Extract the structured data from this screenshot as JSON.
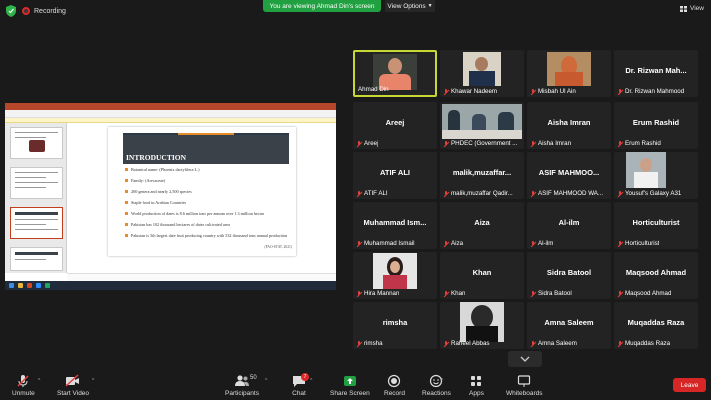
{
  "topbar": {
    "recording_label": "Recording",
    "share_banner": "You are viewing Ahmad Din's screen",
    "view_options_label": "View Options",
    "view_label": "View"
  },
  "screen": {
    "slide_title": "INTRODUCTION",
    "bullets": [
      "Botanical name: (Phoenix dactylifera L.)",
      "Family: (Arecaceae)",
      "200 genera and nearly 2,500 species",
      "Staple food in Arabian Countries",
      "World production of dates is 8.6 million tons per annum over 1.3 million hectar",
      "Pakistan has 102 thousand hectares of dates cultivated area",
      "Pakistan is 5th largest date fruit producing country with 532 thousand tons annual production"
    ],
    "source_note": "(FAO-STAT, 2021)"
  },
  "participants": [
    {
      "big": "",
      "label": "Ahmad Din",
      "muted": false,
      "photo": "ahmad",
      "active": true
    },
    {
      "big": "",
      "label": "Khawar Nadeem",
      "muted": true,
      "photo": "khawar",
      "active": false
    },
    {
      "big": "",
      "label": "Misbah Ul Ain",
      "muted": true,
      "photo": "misbah",
      "active": false
    },
    {
      "big": "Dr. Rizwan Mah...",
      "label": "Dr. Rizwan Mahmood",
      "muted": true,
      "photo": "",
      "active": false
    },
    {
      "big": "Areej",
      "label": "Areej",
      "muted": true,
      "photo": "",
      "active": false
    },
    {
      "big": "",
      "label": "PHDEC (Government ...",
      "muted": true,
      "photo": "phdec",
      "active": false
    },
    {
      "big": "Aisha Imran",
      "label": "Aisha Imran",
      "muted": true,
      "photo": "",
      "active": false
    },
    {
      "big": "Erum Rashid",
      "label": "Erum Rashid",
      "muted": true,
      "photo": "",
      "active": false
    },
    {
      "big": "ATIF ALI",
      "label": "ATIF ALI",
      "muted": true,
      "photo": "",
      "active": false
    },
    {
      "big": "malik,muzaffar...",
      "label": "malik,muzaffar Qadir...",
      "muted": true,
      "photo": "",
      "active": false
    },
    {
      "big": "ASIF MAHMOO...",
      "label": "ASIF MAHMOOD WA...",
      "muted": true,
      "photo": "",
      "active": false
    },
    {
      "big": "",
      "label": "Yousuf's Galaxy A31",
      "muted": true,
      "photo": "galaxy",
      "active": false
    },
    {
      "big": "Muhammad Ism...",
      "label": "Muhammad Ismail",
      "muted": true,
      "photo": "",
      "active": false
    },
    {
      "big": "Aiza",
      "label": "Aiza",
      "muted": true,
      "photo": "",
      "active": false
    },
    {
      "big": "Al-ilm",
      "label": "Al-ilm",
      "muted": true,
      "photo": "",
      "active": false
    },
    {
      "big": "Horticulturist",
      "label": "Horticulturist",
      "muted": true,
      "photo": "",
      "active": false
    },
    {
      "big": "",
      "label": "Hira Mannan",
      "muted": true,
      "photo": "hira",
      "active": false
    },
    {
      "big": "Khan",
      "label": "Khan",
      "muted": true,
      "photo": "",
      "active": false
    },
    {
      "big": "Sidra Batool",
      "label": "Sidra Batool",
      "muted": true,
      "photo": "",
      "active": false
    },
    {
      "big": "Maqsood Ahmad",
      "label": "Maqsood Ahmad",
      "muted": true,
      "photo": "",
      "active": false
    },
    {
      "big": "rimsha",
      "label": "rimsha",
      "muted": true,
      "photo": "",
      "active": false
    },
    {
      "big": "",
      "label": "Raheel Abbas",
      "muted": true,
      "photo": "raheel",
      "active": false
    },
    {
      "big": "Amna Saleem",
      "label": "Amna Saleem",
      "muted": true,
      "photo": "",
      "active": false
    },
    {
      "big": "Muqaddas Raza",
      "label": "Muqaddas Raza",
      "muted": true,
      "photo": "",
      "active": false
    }
  ],
  "toolbar": {
    "unmute": "Unmute",
    "start_video": "Start Video",
    "participants": "Participants",
    "participants_count": "50",
    "chat": "Chat",
    "chat_badge": "7",
    "share_screen": "Share Screen",
    "record": "Record",
    "reactions": "Reactions",
    "apps": "Apps",
    "whiteboards": "Whiteboards",
    "leave": "Leave"
  },
  "colors": {
    "share_green": "#20a040",
    "active_speaker": "#c7d834",
    "leave_red": "#d62626",
    "muted_red": "#e5413c",
    "slide_accent": "#e48c2a"
  }
}
